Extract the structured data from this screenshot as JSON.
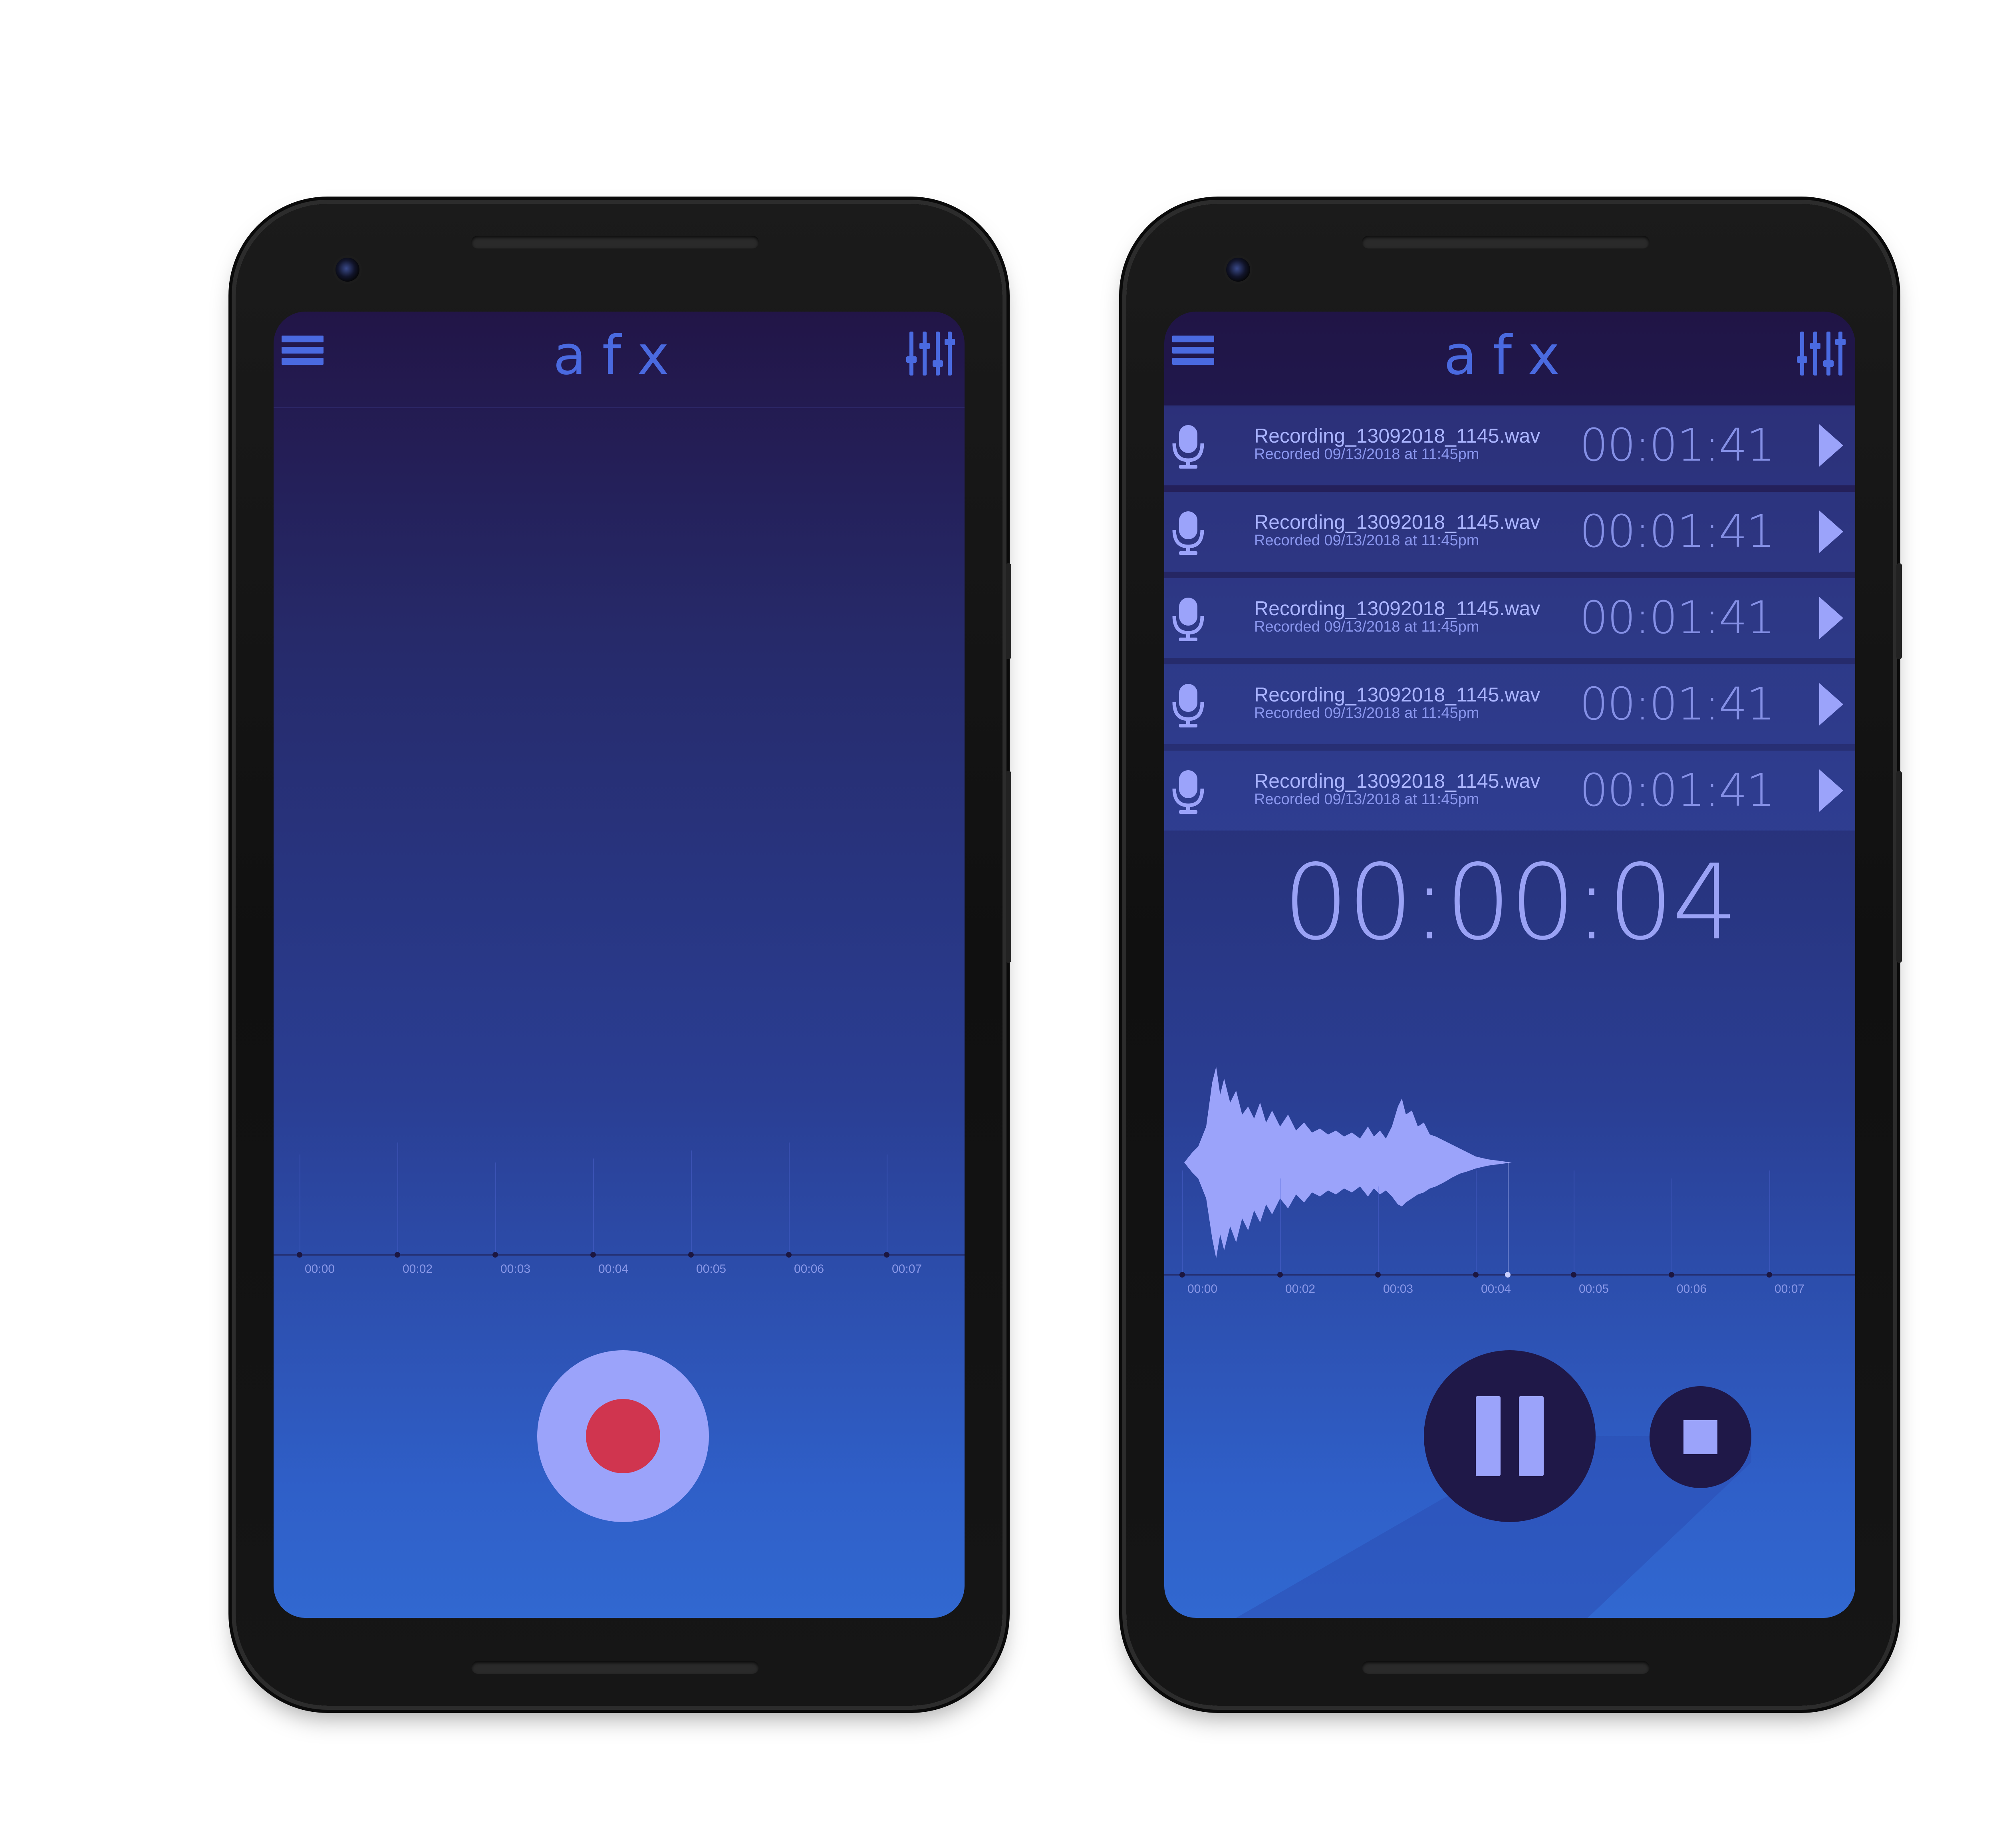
{
  "colors": {
    "accent": "#4a6ae0",
    "light_accent": "#9ba3fa",
    "record_red": "#d0354f",
    "control_dark": "#1f1848"
  },
  "icons": {
    "menu": "hamburger-menu-icon",
    "equalizer": "equalizer-sliders-icon",
    "mic": "microphone-icon",
    "play": "play-triangle-icon",
    "pause": "pause-icon",
    "stop": "stop-icon",
    "record": "record-dot-icon"
  },
  "left_screen": {
    "app_title": "afx",
    "timeline_labels": [
      "00:00",
      "00:02",
      "00:03",
      "00:04",
      "00:05",
      "00:06",
      "00:07"
    ]
  },
  "right_screen": {
    "app_title": "afx",
    "recordings": [
      {
        "name": "Recording_13092018_1145.wav",
        "date": "Recorded 09/13/2018 at 11:45pm",
        "duration": "00:01:41"
      },
      {
        "name": "Recording_13092018_1145.wav",
        "date": "Recorded 09/13/2018 at 11:45pm",
        "duration": "00:01:41"
      },
      {
        "name": "Recording_13092018_1145.wav",
        "date": "Recorded 09/13/2018 at 11:45pm",
        "duration": "00:01:41"
      },
      {
        "name": "Recording_13092018_1145.wav",
        "date": "Recorded 09/13/2018 at 11:45pm",
        "duration": "00:01:41"
      },
      {
        "name": "Recording_13092018_1145.wav",
        "date": "Recorded 09/13/2018 at 11:45pm",
        "duration": "00:01:41"
      }
    ],
    "elapsed_time": "00:00:04",
    "timeline_labels": [
      "00:00",
      "00:02",
      "00:03",
      "00:04",
      "00:05",
      "00:06",
      "00:07"
    ]
  }
}
